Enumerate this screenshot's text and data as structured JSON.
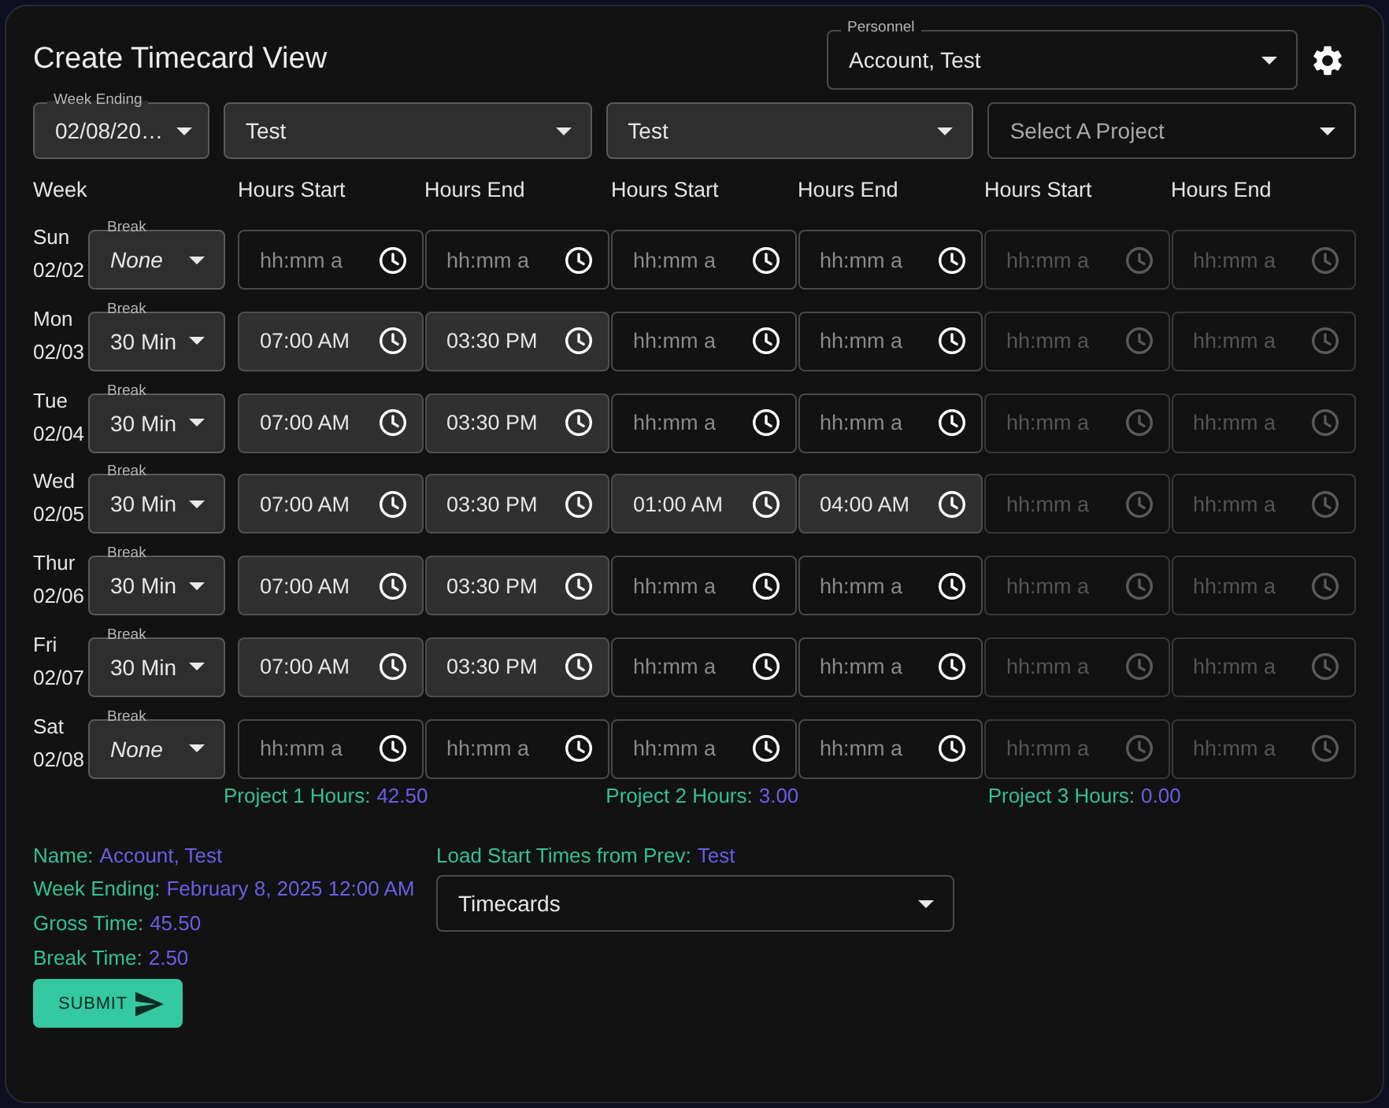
{
  "title": "Create Timecard View",
  "personnel": {
    "label": "Personnel",
    "value": "Account, Test"
  },
  "filters": [
    {
      "label": "Week Ending",
      "value": "02/08/20…",
      "filled": true
    },
    {
      "value": "Test",
      "filled": true
    },
    {
      "value": "Test",
      "filled": true
    },
    {
      "placeholder": "Select A Project",
      "filled": false
    }
  ],
  "columns": [
    "Week",
    "Hours Start",
    "Hours End",
    "Hours Start",
    "Hours End",
    "Hours Start",
    "Hours End"
  ],
  "days": [
    {
      "day": "Sun",
      "date": "02/02",
      "break": {
        "label": "Break",
        "value": "None",
        "unset": true
      },
      "times": [
        {
          "placeholder": "hh:mm a",
          "disabled": false
        },
        {
          "placeholder": "hh:mm a",
          "disabled": false
        },
        {
          "placeholder": "hh:mm a",
          "disabled": false
        },
        {
          "placeholder": "hh:mm a",
          "disabled": false
        },
        {
          "placeholder": "hh:mm a",
          "disabled": true
        },
        {
          "placeholder": "hh:mm a",
          "disabled": true
        }
      ]
    },
    {
      "day": "Mon",
      "date": "02/03",
      "break": {
        "label": "Break",
        "value": "30 Min",
        "unset": false
      },
      "times": [
        {
          "value": "07:00 AM",
          "disabled": false
        },
        {
          "value": "03:30 PM",
          "disabled": false
        },
        {
          "placeholder": "hh:mm a",
          "disabled": false
        },
        {
          "placeholder": "hh:mm a",
          "disabled": false
        },
        {
          "placeholder": "hh:mm a",
          "disabled": true
        },
        {
          "placeholder": "hh:mm a",
          "disabled": true
        }
      ]
    },
    {
      "day": "Tue",
      "date": "02/04",
      "break": {
        "label": "Break",
        "value": "30 Min",
        "unset": false
      },
      "times": [
        {
          "value": "07:00 AM",
          "disabled": false
        },
        {
          "value": "03:30 PM",
          "disabled": false
        },
        {
          "placeholder": "hh:mm a",
          "disabled": false
        },
        {
          "placeholder": "hh:mm a",
          "disabled": false
        },
        {
          "placeholder": "hh:mm a",
          "disabled": true
        },
        {
          "placeholder": "hh:mm a",
          "disabled": true
        }
      ]
    },
    {
      "day": "Wed",
      "date": "02/05",
      "break": {
        "label": "Break",
        "value": "30 Min",
        "unset": false
      },
      "times": [
        {
          "value": "07:00 AM",
          "disabled": false
        },
        {
          "value": "03:30 PM",
          "disabled": false
        },
        {
          "value": "01:00 AM",
          "disabled": false
        },
        {
          "value": "04:00 AM",
          "disabled": false
        },
        {
          "placeholder": "hh:mm a",
          "disabled": true
        },
        {
          "placeholder": "hh:mm a",
          "disabled": true
        }
      ]
    },
    {
      "day": "Thur",
      "date": "02/06",
      "break": {
        "label": "Break",
        "value": "30 Min",
        "unset": false
      },
      "times": [
        {
          "value": "07:00 AM",
          "disabled": false
        },
        {
          "value": "03:30 PM",
          "disabled": false
        },
        {
          "placeholder": "hh:mm a",
          "disabled": false
        },
        {
          "placeholder": "hh:mm a",
          "disabled": false
        },
        {
          "placeholder": "hh:mm a",
          "disabled": true
        },
        {
          "placeholder": "hh:mm a",
          "disabled": true
        }
      ]
    },
    {
      "day": "Fri",
      "date": "02/07",
      "break": {
        "label": "Break",
        "value": "30 Min",
        "unset": false
      },
      "times": [
        {
          "value": "07:00 AM",
          "disabled": false
        },
        {
          "value": "03:30 PM",
          "disabled": false
        },
        {
          "placeholder": "hh:mm a",
          "disabled": false
        },
        {
          "placeholder": "hh:mm a",
          "disabled": false
        },
        {
          "placeholder": "hh:mm a",
          "disabled": true
        },
        {
          "placeholder": "hh:mm a",
          "disabled": true
        }
      ]
    },
    {
      "day": "Sat",
      "date": "02/08",
      "break": {
        "label": "Break",
        "value": "None",
        "unset": true
      },
      "times": [
        {
          "placeholder": "hh:mm a",
          "disabled": false
        },
        {
          "placeholder": "hh:mm a",
          "disabled": false
        },
        {
          "placeholder": "hh:mm a",
          "disabled": false
        },
        {
          "placeholder": "hh:mm a",
          "disabled": false
        },
        {
          "placeholder": "hh:mm a",
          "disabled": true
        },
        {
          "placeholder": "hh:mm a",
          "disabled": true
        }
      ]
    }
  ],
  "project_totals": [
    {
      "label": "Project 1 Hours:",
      "value": "42.50"
    },
    {
      "label": "Project 2 Hours:",
      "value": "3.00"
    },
    {
      "label": "Project 3 Hours:",
      "value": "0.00"
    }
  ],
  "summary": [
    {
      "label": "Name:",
      "value": "Account, Test"
    },
    {
      "label": "Week Ending:",
      "value": "February 8, 2025 12:00 AM"
    },
    {
      "label": "Gross Time:",
      "value": "45.50"
    },
    {
      "label": "Break Time:",
      "value": "2.50"
    }
  ],
  "load_previous": {
    "label": "Load Start Times from Prev:",
    "value": "Test"
  },
  "timecards_select": {
    "value": "Timecards"
  },
  "submit": {
    "label": "SUBMIT"
  }
}
